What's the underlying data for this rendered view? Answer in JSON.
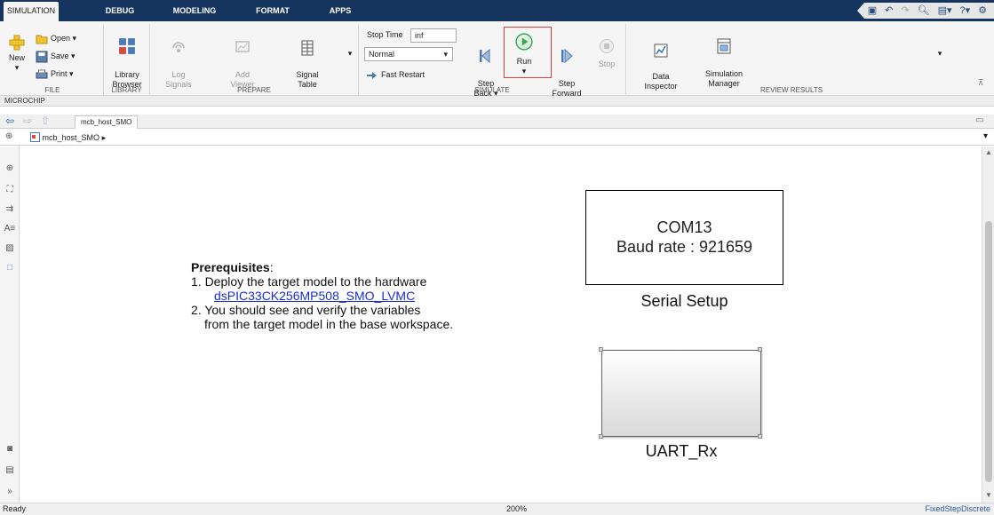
{
  "tabs": [
    {
      "label": "SIMULATION",
      "active": true
    },
    {
      "label": "DEBUG"
    },
    {
      "label": "MODELING"
    },
    {
      "label": "FORMAT"
    },
    {
      "label": "APPS"
    }
  ],
  "ribbon": {
    "file": {
      "new": "New",
      "open": "Open",
      "save": "Save",
      "print": "Print",
      "label": "FILE"
    },
    "library": {
      "browser": "Library\nBrowser",
      "label": "LIBRARY"
    },
    "prepare": {
      "log": "Log\nSignals",
      "add_viewer": "Add\nViewer",
      "signal_table": "Signal\nTable",
      "label": "PREPARE"
    },
    "simulate": {
      "stop_time_label": "Stop Time",
      "stop_time_value": "inf",
      "mode": "Normal",
      "fast_restart": "Fast Restart",
      "step_back": "Step\nBack",
      "run": "Run",
      "step_forward": "Step\nForward",
      "stop": "Stop",
      "label": "SIMULATE"
    },
    "review": {
      "data_inspector": "Data\nInspector",
      "sim_manager": "Simulation\nManager",
      "label": "REVIEW RESULTS"
    }
  },
  "microchip_bar": "MICROCHIP",
  "model_tab": "mcb_host_SMO",
  "breadcrumb": "mcb_host_SMO",
  "canvas": {
    "prereq_title": "Prerequisites",
    "prereq_title_suffix": ":",
    "line1": "1. Deploy the target model to the hardware",
    "link": "dsPIC33CK256MP508_SMO_LVMC",
    "line2": "2. You should see and verify the variables",
    "line3": "from the target model in the base workspace.",
    "serial_line1": "COM13",
    "serial_line2": "Baud rate : 921659",
    "serial_label": "Serial Setup",
    "uart_label": "UART_Rx"
  },
  "status": {
    "left": "Ready",
    "zoom": "200%",
    "solver": "FixedStepDiscrete"
  },
  "colors": {
    "tabstrip": "#15355e",
    "link": "#1a2ecf",
    "run_highlight": "#e23b3b",
    "run_icon": "#3aa655"
  }
}
